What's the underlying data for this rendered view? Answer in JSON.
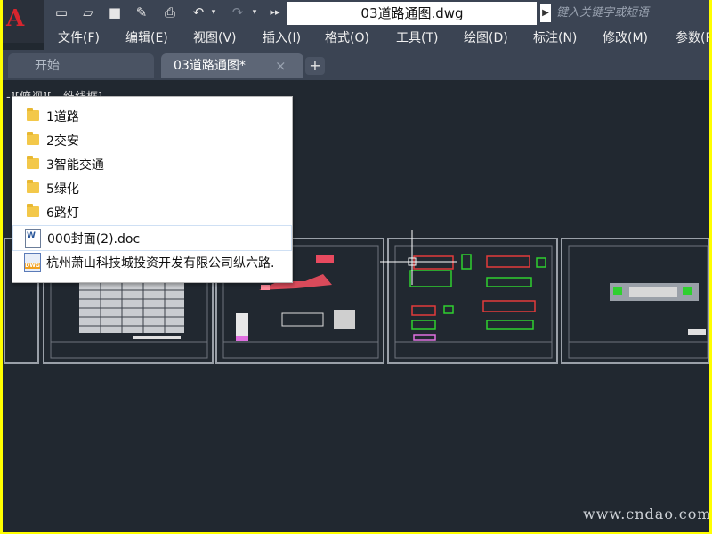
{
  "window": {
    "document_title": "03道路通图.dwg",
    "search_placeholder": "键入关键字或短语"
  },
  "menu": [
    {
      "label": "文件(F)"
    },
    {
      "label": "编辑(E)"
    },
    {
      "label": "视图(V)"
    },
    {
      "label": "插入(I)"
    },
    {
      "label": "格式(O)"
    },
    {
      "label": "工具(T)"
    },
    {
      "label": "绘图(D)"
    },
    {
      "label": "标注(N)"
    },
    {
      "label": "修改(M)"
    },
    {
      "label": "参数(P"
    }
  ],
  "tabs": {
    "start": "开始",
    "drawing": "03道路通图*",
    "close_glyph": "×",
    "add_glyph": "+"
  },
  "viewport_label": "-][俯视][二维线框]",
  "popup": {
    "items": [
      {
        "label": "1道路",
        "icon": "folder-icon"
      },
      {
        "label": "2交安",
        "icon": "folder-icon"
      },
      {
        "label": "3智能交通",
        "icon": "folder-icon"
      },
      {
        "label": "5绿化",
        "icon": "folder-icon"
      },
      {
        "label": "6路灯",
        "icon": "folder-icon"
      },
      {
        "label": "000封面(2).doc",
        "icon": "word-doc-icon"
      },
      {
        "label": "杭州萧山科技城投资开发有限公司纵六路.",
        "icon": "dwg-file-icon"
      }
    ]
  },
  "watermark": "www.cndao.com",
  "colors": {
    "background_border": "#ffff00",
    "canvas": "#212830",
    "chrome": "#3b4453",
    "accent_red": "#d8252e"
  }
}
